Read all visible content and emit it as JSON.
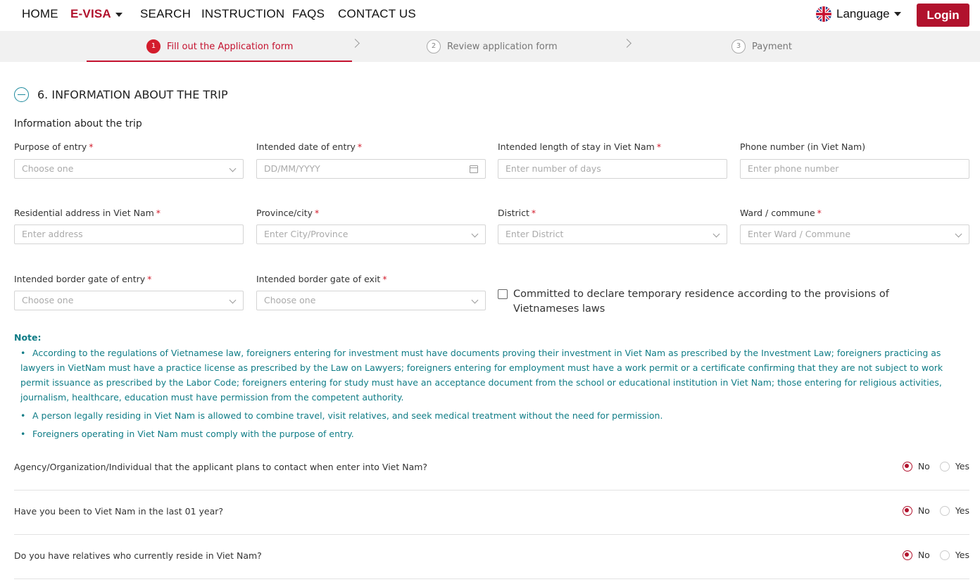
{
  "nav": {
    "items": [
      "HOME",
      "E-VISA",
      "SEARCH",
      "INSTRUCTION",
      "FAQS",
      "CONTACT US"
    ],
    "active": "E-VISA",
    "language_label": "Language",
    "login_label": "Login"
  },
  "steps": [
    {
      "num": "1",
      "label": "Fill out the Application form"
    },
    {
      "num": "2",
      "label": "Review application form"
    },
    {
      "num": "3",
      "label": "Payment"
    }
  ],
  "section": {
    "title": "6. INFORMATION ABOUT THE TRIP",
    "subtitle": "Information about the trip"
  },
  "fields": {
    "purpose": {
      "label": "Purpose of entry",
      "placeholder": "Choose one"
    },
    "entry_date": {
      "label": "Intended date of entry",
      "placeholder": "DD/MM/YYYY"
    },
    "length_stay": {
      "label": "Intended length of stay in Viet Nam",
      "placeholder": "Enter number of days"
    },
    "phone": {
      "label": "Phone number (in Viet Nam)",
      "placeholder": "Enter phone number"
    },
    "address": {
      "label": "Residential address in Viet Nam",
      "placeholder": "Enter address"
    },
    "province": {
      "label": "Province/city",
      "placeholder": "Enter City/Province"
    },
    "district": {
      "label": "District",
      "placeholder": "Enter District"
    },
    "ward": {
      "label": "Ward / commune",
      "placeholder": "Enter Ward / Commune"
    },
    "gate_entry": {
      "label": "Intended border gate of entry",
      "placeholder": "Choose one"
    },
    "gate_exit": {
      "label": "Intended border gate of exit",
      "placeholder": "Choose one"
    }
  },
  "commit_checkbox": {
    "label": "Committed to declare temporary residence according to the provisions of Vietnameses laws",
    "checked": false
  },
  "note": {
    "title": "Note:",
    "items": [
      "According to the regulations of Vietnamese law, foreigners entering for investment must have documents proving their investment in Viet Nam as prescribed by the Investment Law; foreigners practicing as lawyers in VietNam must have a practice license as prescribed by the Law on Lawyers; foreigners entering for employment must have a work permit or a certificate confirming that they are not subject to work permit issuance as prescribed by the Labor Code; foreigners entering for study must have an acceptance document from the school or educational institution in Viet Nam; those entering for religious activities, journalism, healthcare, education must have permission from the competent authority.",
      "A person legally residing in Viet Nam is allowed to combine travel, visit relatives, and seek medical treatment without the need for permission.",
      "Foreigners operating in Viet Nam must comply with the purpose of entry."
    ]
  },
  "questions": [
    {
      "text": "Agency/Organization/Individual that the applicant plans to contact when enter into Viet Nam?",
      "no": "No",
      "yes": "Yes",
      "selected": "No"
    },
    {
      "text": "Have you been to Viet Nam in the last 01 year?",
      "no": "No",
      "yes": "Yes",
      "selected": "No"
    },
    {
      "text": "Do you have relatives who currently reside in Viet Nam?",
      "no": "No",
      "yes": "Yes",
      "selected": "No"
    }
  ],
  "colors": {
    "brand": "#b1122d",
    "note": "#0f7c86",
    "accent": "#1e8a9e"
  }
}
